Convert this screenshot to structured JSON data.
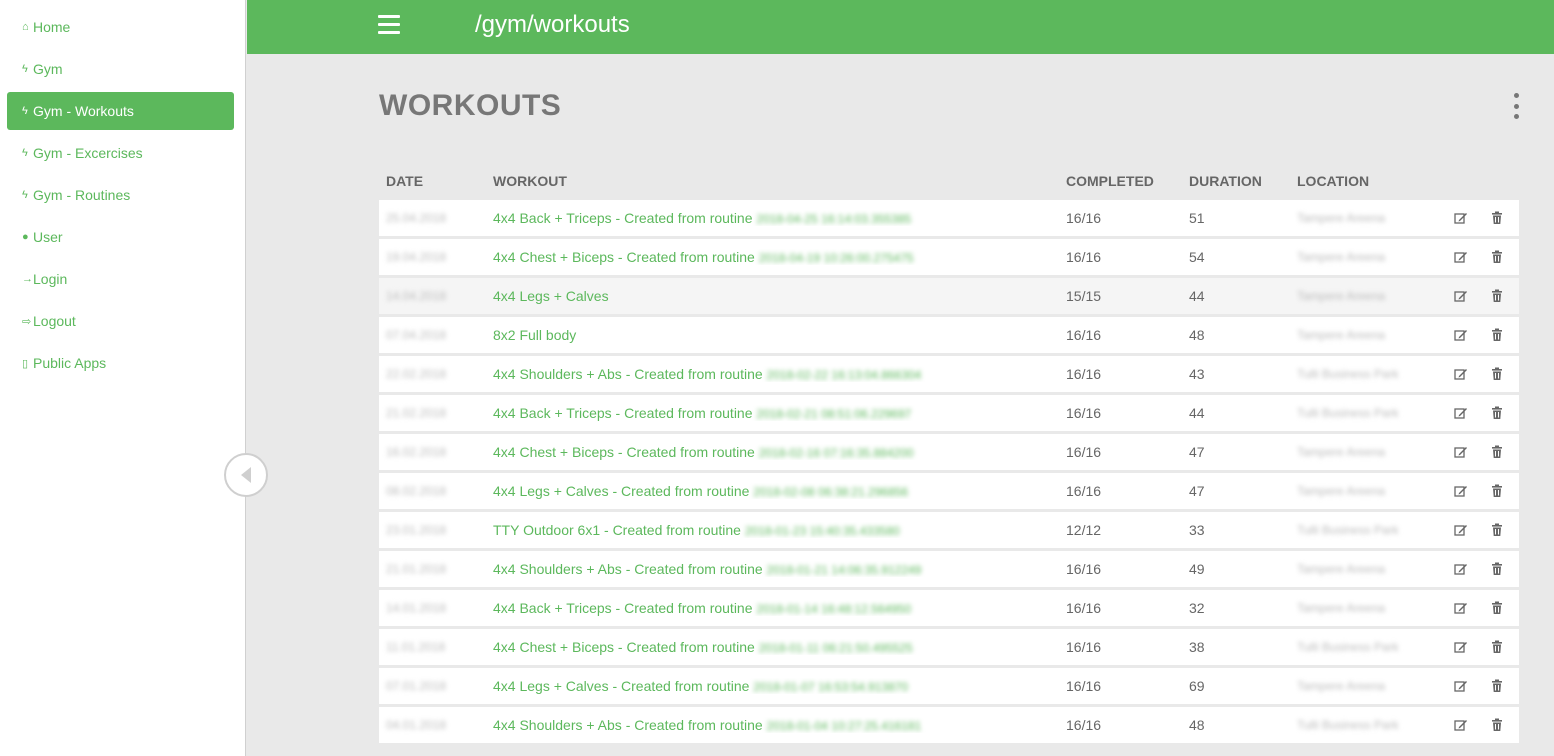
{
  "sidebar": {
    "items": [
      {
        "icon": "home-icon",
        "glyph": "⌂",
        "label": "Home",
        "active": false
      },
      {
        "icon": "bolt-icon",
        "glyph": "ϟ",
        "label": "Gym",
        "active": false
      },
      {
        "icon": "bolt-icon",
        "glyph": "ϟ",
        "label": "Gym - Workouts",
        "active": true
      },
      {
        "icon": "bolt-icon",
        "glyph": "ϟ",
        "label": "Gym - Excercises",
        "active": false
      },
      {
        "icon": "bolt-icon",
        "glyph": "ϟ",
        "label": "Gym - Routines",
        "active": false
      },
      {
        "icon": "user-icon",
        "glyph": "●",
        "label": "User",
        "active": false
      },
      {
        "icon": "login-icon",
        "glyph": "→",
        "label": "Login",
        "active": false
      },
      {
        "icon": "logout-icon",
        "glyph": "⇨",
        "label": "Logout",
        "active": false
      },
      {
        "icon": "mobile-icon",
        "glyph": "▯",
        "label": "Public Apps",
        "active": false
      }
    ]
  },
  "header": {
    "route": "/gym/workouts"
  },
  "main": {
    "title": "WORKOUTS",
    "columns": {
      "date": "DATE",
      "workout": "WORKOUT",
      "completed": "COMPLETED",
      "duration": "DURATION",
      "location": "LOCATION"
    },
    "rows": [
      {
        "date": "25.04.2018",
        "workout": "4x4 Back + Triceps - Created from routine",
        "workout_suffix": "2018-04-25 16:14:03.355385",
        "completed": "16/16",
        "duration": "51",
        "location": "Tampere Areena"
      },
      {
        "date": "19.04.2018",
        "workout": "4x4 Chest + Biceps - Created from routine",
        "workout_suffix": "2018-04-19 10:26:00.275475",
        "completed": "16/16",
        "duration": "54",
        "location": "Tampere Areena"
      },
      {
        "date": "14.04.2018",
        "workout": "4x4 Legs + Calves",
        "workout_suffix": "",
        "completed": "15/15",
        "duration": "44",
        "location": "Tampere Areena"
      },
      {
        "date": "07.04.2018",
        "workout": "8x2 Full body",
        "workout_suffix": "",
        "completed": "16/16",
        "duration": "48",
        "location": "Tampere Areena"
      },
      {
        "date": "22.02.2018",
        "workout": "4x4 Shoulders + Abs - Created from routine",
        "workout_suffix": "2018-02-22 16:13:04.866304",
        "completed": "16/16",
        "duration": "43",
        "location": "Tulli Business Park"
      },
      {
        "date": "21.02.2018",
        "workout": "4x4 Back + Triceps - Created from routine",
        "workout_suffix": "2018-02-21 08:51:06.229697",
        "completed": "16/16",
        "duration": "44",
        "location": "Tulli Business Park"
      },
      {
        "date": "16.02.2018",
        "workout": "4x4 Chest + Biceps - Created from routine",
        "workout_suffix": "2018-02-16 07:16:35.884200",
        "completed": "16/16",
        "duration": "47",
        "location": "Tampere Areena"
      },
      {
        "date": "08.02.2018",
        "workout": "4x4 Legs + Calves - Created from routine",
        "workout_suffix": "2018-02-08 06:38:21.296856",
        "completed": "16/16",
        "duration": "47",
        "location": "Tampere Areena"
      },
      {
        "date": "23.01.2018",
        "workout": "TTY Outdoor 6x1 - Created from routine",
        "workout_suffix": "2018-01-23 15:40:35.433580",
        "completed": "12/12",
        "duration": "33",
        "location": "Tulli Business Park"
      },
      {
        "date": "21.01.2018",
        "workout": "4x4 Shoulders + Abs - Created from routine",
        "workout_suffix": "2018-01-21 14:06:35.912249",
        "completed": "16/16",
        "duration": "49",
        "location": "Tampere Areena"
      },
      {
        "date": "14.01.2018",
        "workout": "4x4 Back + Triceps - Created from routine",
        "workout_suffix": "2018-01-14 16:48:12.564950",
        "completed": "16/16",
        "duration": "32",
        "location": "Tampere Areena"
      },
      {
        "date": "11.01.2018",
        "workout": "4x4 Chest + Biceps - Created from routine",
        "workout_suffix": "2018-01-11 06:21:50.495525",
        "completed": "16/16",
        "duration": "38",
        "location": "Tulli Business Park"
      },
      {
        "date": "07.01.2018",
        "workout": "4x4 Legs + Calves - Created from routine",
        "workout_suffix": "2018-01-07 16:53:54.913870",
        "completed": "16/16",
        "duration": "69",
        "location": "Tampere Areena"
      },
      {
        "date": "04.01.2018",
        "workout": "4x4 Shoulders + Abs - Created from routine",
        "workout_suffix": "2018-01-04 10:27:25.416181",
        "completed": "16/16",
        "duration": "48",
        "location": "Tulli Business Park"
      }
    ]
  },
  "colors": {
    "accent": "#5cb85c",
    "page_bg": "#e9e9e9",
    "title": "#777777"
  }
}
